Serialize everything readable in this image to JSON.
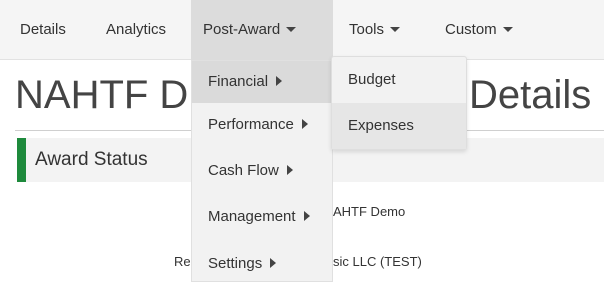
{
  "nav": {
    "items": [
      {
        "label": "Details",
        "has_caret": false
      },
      {
        "label": "Analytics",
        "has_caret": false
      },
      {
        "label": "Post-Award",
        "has_caret": true,
        "active": true
      },
      {
        "label": "Tools",
        "has_caret": true
      },
      {
        "label": "Custom",
        "has_caret": true
      }
    ]
  },
  "page": {
    "title_left": "NAHTF D",
    "title_right": "Details"
  },
  "section": {
    "title": "Award Status"
  },
  "fields": {
    "program_value_visible": "AHTF Demo",
    "recipient_label_visible": "Re",
    "recipient_value_visible": "sic LLC (TEST)"
  },
  "dropdown": {
    "items": [
      {
        "label": "Financial",
        "highlighted": true
      },
      {
        "label": "Performance"
      },
      {
        "label": "Cash Flow"
      },
      {
        "label": "Management"
      },
      {
        "label": "Settings"
      }
    ]
  },
  "submenu": {
    "items": [
      {
        "label": "Budget"
      },
      {
        "label": "Expenses",
        "highlighted": true
      }
    ]
  },
  "colors": {
    "navbar_bg": "#f5f5f5",
    "active_nav_bg": "#dcdcdc",
    "section_accent": "#1e8a3c",
    "dropdown_bg": "#f2f2f2"
  }
}
